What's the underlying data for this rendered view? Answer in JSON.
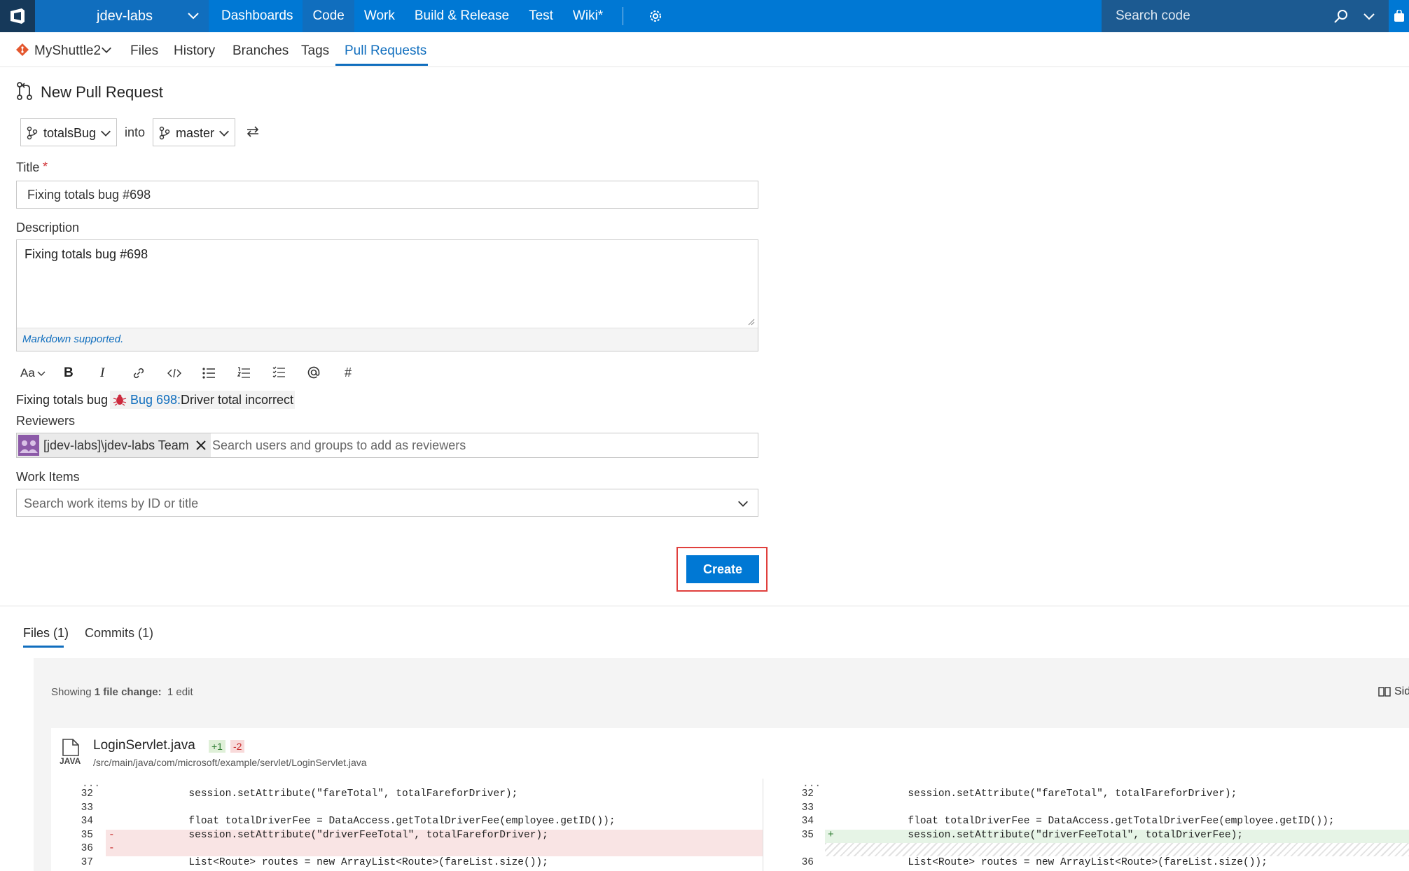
{
  "topbar": {
    "project": "jdev-labs",
    "nav": [
      "Dashboards",
      "Code",
      "Work",
      "Build & Release",
      "Test",
      "Wiki*"
    ],
    "active_nav": "Code",
    "search_placeholder": "Search code"
  },
  "subnav": {
    "repo": "MyShuttle2",
    "items": [
      "Files",
      "History",
      "Branches",
      "Tags",
      "Pull Requests"
    ],
    "active": "Pull Requests"
  },
  "page": {
    "title": "New Pull Request",
    "source_branch": "totalsBug",
    "into": "into",
    "target_branch": "master"
  },
  "form": {
    "title_label": "Title",
    "required_mark": "*",
    "title_value": "Fixing totals bug #698",
    "description_label": "Description",
    "description_value": "Fixing totals bug #698",
    "markdown_hint": "Markdown supported.",
    "toolbar": [
      "Aa",
      "B",
      "I",
      "#"
    ],
    "linked_text": "Fixing totals bug",
    "linked_bug_id": "Bug 698:",
    "linked_bug_title": "Driver total incorrect",
    "reviewers_label": "Reviewers",
    "reviewer_chip": "[jdev-labs]\\jdev-labs Team",
    "reviewer_placeholder": "Search users and groups to add as reviewers",
    "workitems_label": "Work Items",
    "workitems_placeholder": "Search work items by ID or title",
    "create_button": "Create"
  },
  "tabs": {
    "files": "Files (1)",
    "commits": "Commits (1)"
  },
  "changes": {
    "summary_prefix": "Showing",
    "summary_bold": "1 file change:",
    "summary_edit": "1 edit",
    "view_toggle": "Sid",
    "file_name": "LoginServlet.java",
    "file_type": "JAVA",
    "adds": "+1",
    "dels": "-2",
    "file_path": "/src/main/java/com/microsoft/example/servlet/LoginServlet.java",
    "ellipsis": "...",
    "left_lines": [
      {
        "num": "32",
        "mark": "",
        "code": "            session.setAttribute(\"fareTotal\", totalFareforDriver);",
        "hl": ""
      },
      {
        "num": "33",
        "mark": "",
        "code": "",
        "hl": ""
      },
      {
        "num": "34",
        "mark": "",
        "code": "            float totalDriverFee = DataAccess.getTotalDriverFee(employee.getID());",
        "hl": ""
      },
      {
        "num": "35",
        "mark": "-",
        "code": "            session.setAttribute(\"driverFeeTotal\", totalFareforDriver);",
        "hl": "del"
      },
      {
        "num": "36",
        "mark": "-",
        "code": "",
        "hl": "del"
      },
      {
        "num": "37",
        "mark": "",
        "code": "            List<Route> routes = new ArrayList<Route>(fareList.size());",
        "hl": ""
      }
    ],
    "right_lines": [
      {
        "num": "32",
        "mark": "",
        "code": "            session.setAttribute(\"fareTotal\", totalFareforDriver);",
        "hl": ""
      },
      {
        "num": "33",
        "mark": "",
        "code": "",
        "hl": ""
      },
      {
        "num": "34",
        "mark": "",
        "code": "            float totalDriverFee = DataAccess.getTotalDriverFee(employee.getID());",
        "hl": ""
      },
      {
        "num": "35",
        "mark": "+",
        "code": "            session.setAttribute(\"driverFeeTotal\", totalDriverFee);",
        "hl": "add"
      },
      {
        "num": "",
        "mark": "",
        "code": "",
        "hl": "hatch"
      },
      {
        "num": "36",
        "mark": "",
        "code": "            List<Route> routes = new ArrayList<Route>(fareList.size());",
        "hl": ""
      }
    ]
  },
  "colors": {
    "accent": "#0078d4",
    "create_outline": "#e0403d",
    "del_bg": "#f9e4e4",
    "add_bg": "#e6f4e6"
  }
}
